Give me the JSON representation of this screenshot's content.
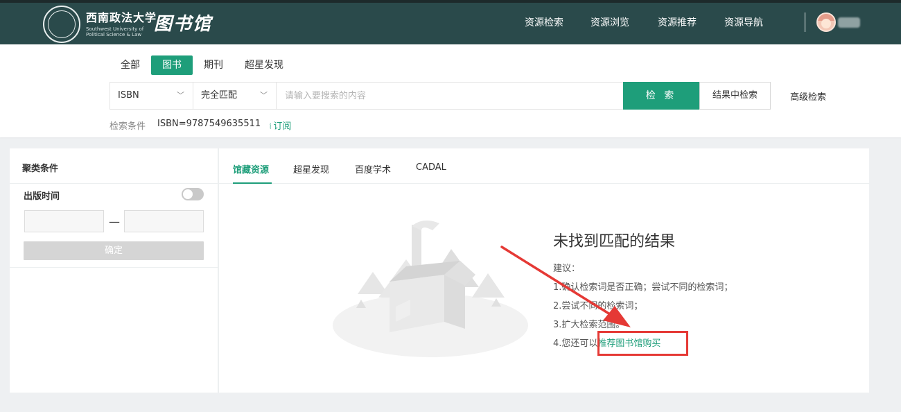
{
  "header": {
    "logo_cn": "西南政法大学",
    "logo_en": "Southwest University of Political Science & Law",
    "library": "图书馆",
    "nav": [
      "资源检索",
      "资源浏览",
      "资源推荐",
      "资源导航"
    ]
  },
  "search": {
    "tabs": [
      "全部",
      "图书",
      "期刊",
      "超星发现"
    ],
    "active_tab": "图书",
    "field_select": "ISBN",
    "match_select": "完全匹配",
    "placeholder": "请输入要搜索的内容",
    "search_button": "检 索",
    "result_search_button": "结果中检索",
    "advanced": "高级检索",
    "criteria_label": "检索条件",
    "criteria_value": "ISBN=9787549635511",
    "subscribe": "订阅"
  },
  "facet": {
    "title": "聚类条件",
    "publish_time": "出版时间",
    "confirm": "确定"
  },
  "results": {
    "tabs": [
      "馆藏资源",
      "超星发现",
      "百度学术",
      "CADAL"
    ],
    "active_tab": "馆藏资源",
    "empty_title": "未找到匹配的结果",
    "suggest_label": "建议：",
    "suggestions": [
      "1.确认检索词是否正确；尝试不同的检索词；",
      "2.尝试不同的检索词；",
      "3.扩大检索范围。"
    ],
    "suggestion4_prefix": "4.您还可以",
    "recommend_link": "推荐图书馆购买"
  },
  "colors": {
    "header_bg": "#2a4a4b",
    "accent": "#1e9e7a",
    "annotation": "#e53935"
  }
}
